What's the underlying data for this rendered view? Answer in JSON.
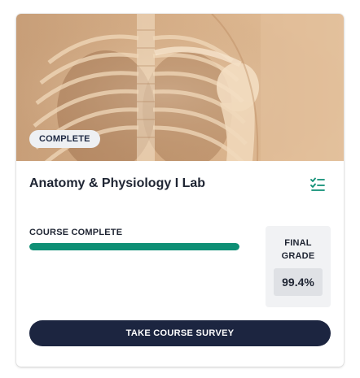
{
  "course": {
    "status_badge": "COMPLETE",
    "title": "Anatomy & Physiology I Lab",
    "image_icon": "xray-chest-image",
    "action_icon": "checklist-icon",
    "accent_color": "#0e8f75"
  },
  "progress": {
    "label": "COURSE COMPLETE",
    "percent": 100
  },
  "grade": {
    "label_line1": "FINAL",
    "label_line2": "GRADE",
    "value": "99.4%"
  },
  "actions": {
    "survey_label": "TAKE COURSE SURVEY",
    "button_color": "#1c2540"
  }
}
